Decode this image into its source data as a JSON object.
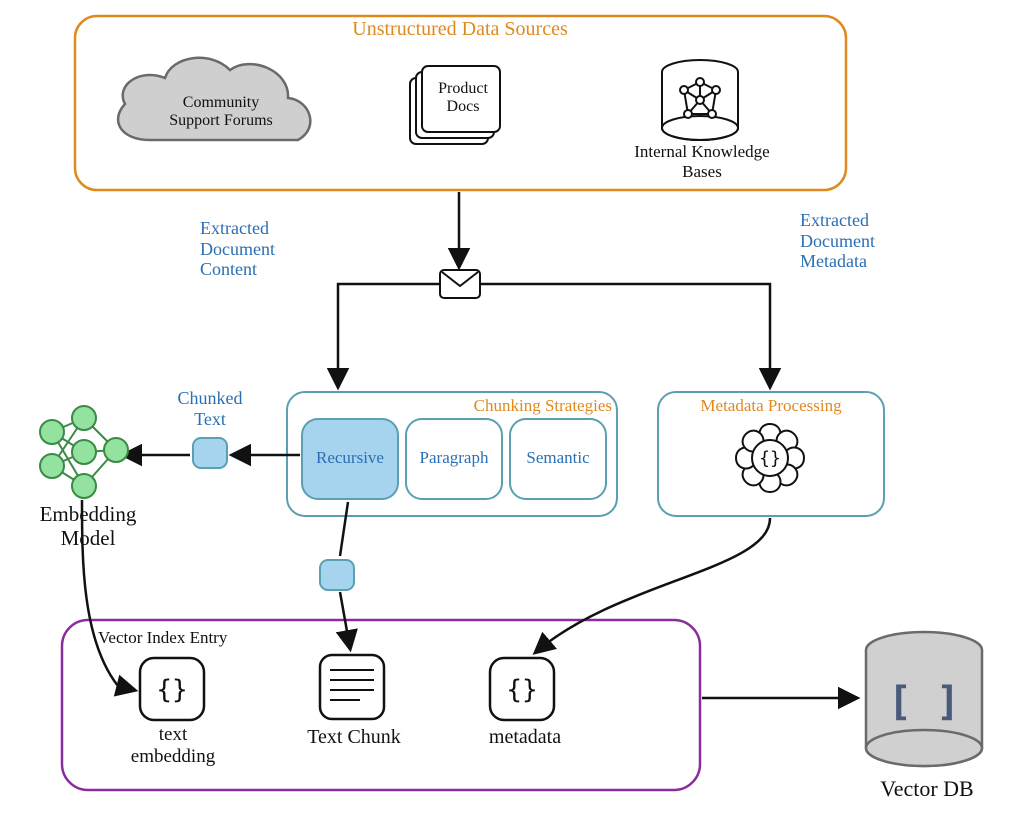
{
  "titles": {
    "unstructured_sources": "Unstructured Data Sources",
    "chunking_strategies": "Chunking Strategies",
    "metadata_processing": "Metadata Processing",
    "vector_index_entry": "Vector Index Entry"
  },
  "sources": {
    "forums": "Community\nSupport Forums",
    "product_docs": "Product\nDocs",
    "knowledge_bases": "Internal Knowledge\nBases"
  },
  "flow_labels": {
    "extracted_content": "Extracted\nDocument\nContent",
    "extracted_metadata": "Extracted\nDocument\nMetadata",
    "chunked_text": "Chunked\nText"
  },
  "chunking": {
    "recursive": "Recursive",
    "paragraph": "Paragraph",
    "semantic": "Semantic"
  },
  "nodes": {
    "embedding_model": "Embedding\nModel",
    "text_embedding": "text\nembedding",
    "text_chunk": "Text Chunk",
    "metadata": "metadata",
    "vector_db": "Vector DB"
  },
  "colors": {
    "orange": "#e08a1e",
    "blue_text": "#2b6fb3",
    "purple": "#8a2d9c",
    "teal": "#5aa0b0",
    "chip_fill": "#a6d4ef",
    "chip_stroke": "#5aa0b0",
    "neuron_fill": "#93e29f",
    "neuron_stroke": "#3a8a46",
    "cloud_fill": "#cfcfcf",
    "cloud_stroke": "#6a6a6a",
    "db_fill": "#d0d0d0",
    "db_stroke": "#6a6a6a",
    "ink": "#111111"
  }
}
